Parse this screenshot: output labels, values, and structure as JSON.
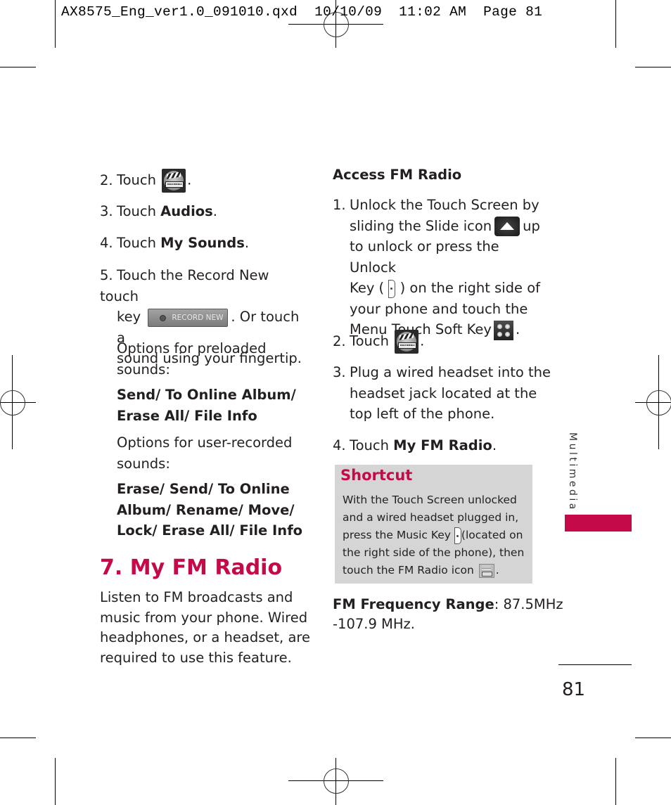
{
  "slug": {
    "filename": "AX8575_Eng_ver1.0_091010.qxd",
    "date": "10/10/09",
    "time": "11:02 AM",
    "page_label": "Page 81"
  },
  "left_column": {
    "steps": [
      {
        "num": "2.",
        "text_before": "Touch",
        "icon": "multimedia-icon",
        "text_after": "."
      },
      {
        "num": "3.",
        "text_before": "Touch ",
        "bold": "Audios",
        "text_after": "."
      },
      {
        "num": "4.",
        "text_before": "Touch ",
        "bold": "My Sounds",
        "text_after": "."
      },
      {
        "num": "5.",
        "line1": "Touch the Record New touch",
        "line2_before": "key",
        "button_label": "RECORD NEW",
        "line2_after": ". Or touch a",
        "line3": "sound using your fingertip."
      }
    ],
    "options_preloaded_label": [
      "Options for preloaded",
      "sounds:"
    ],
    "options_preloaded_values": [
      "Send/ To Online Album/",
      "Erase All/ File Info"
    ],
    "options_user_label": [
      "Options for user-recorded",
      "sounds:"
    ],
    "options_user_values": [
      "Erase/ Send/ To Online",
      "Album/ Rename/ Move/",
      "Lock/ Erase All/ File Info"
    ],
    "section_heading": "7. My FM Radio",
    "section_body": [
      "Listen to FM broadcasts and",
      "music from your phone. Wired",
      "headphones, or a headset, are",
      "required to use this feature."
    ]
  },
  "right_column": {
    "subheading": "Access FM Radio",
    "step1": {
      "num": "1.",
      "l1": "Unlock the Touch Screen by",
      "l2_before": "sliding the Slide icon",
      "l2_after": "up",
      "l3": "to unlock or press the Unlock",
      "l4_before": "Key (",
      "l4_after": ") on the right side of",
      "l5": "your phone and touch the",
      "l6_before": "Menu Touch Soft Key",
      "l6_after": "."
    },
    "step2": {
      "num": "2.",
      "text_before": "Touch",
      "text_after": "."
    },
    "step3": {
      "num": "3.",
      "lines": [
        "Plug a wired headset into the",
        "headset jack located at the",
        "top left of the phone."
      ]
    },
    "step4": {
      "num": "4.",
      "text_before": "Touch ",
      "bold": "My FM Radio",
      "text_after": "."
    },
    "shortcut": {
      "title": "Shortcut",
      "l1": "With the Touch Screen unlocked",
      "l2": "and a wired headset plugged in,",
      "l3_before": "press the Music Key",
      "l3_after": "(located on",
      "l4": "the right side of the phone), then",
      "l5_before": "touch the FM Radio icon",
      "l5_after": "."
    },
    "frequency": {
      "label": "FM Frequency Range",
      "value_l1": ": 87.5MHz",
      "value_l2": "-107.9 MHz."
    }
  },
  "side_tab": {
    "label": "Multimedia",
    "color": "#c40a49"
  },
  "page_number": "81",
  "colors": {
    "accent": "#c40a49",
    "shortcut_bg": "#d5d5d5",
    "text": "#231f20"
  }
}
